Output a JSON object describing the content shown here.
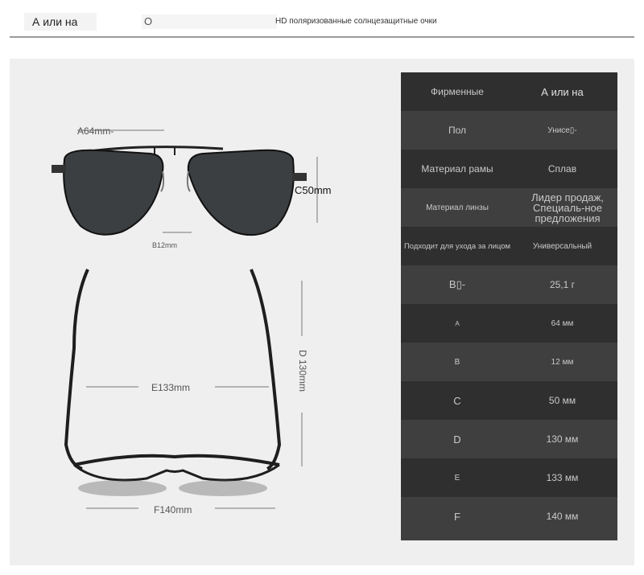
{
  "header": {
    "brand": "А или на",
    "search_glyph": "O",
    "title": "HD поляризованные солнцезащитные очки"
  },
  "dimensions": {
    "a": "A64mm-",
    "b": "B12mm",
    "c": "C50mm",
    "d": "D 130mm",
    "e": "E133mm",
    "f": "F140mm"
  },
  "specs": [
    {
      "key": "Фирменные",
      "value": "А или на"
    },
    {
      "key": "Пол",
      "value": "Унисе▯-"
    },
    {
      "key": "Материал рамы",
      "value": "Сплав"
    },
    {
      "key": "Материал линзы",
      "value": "Лидер продаж, Специаль-ное предложения"
    },
    {
      "key": "Подходит для ухода за лицом",
      "value": "Универсальный"
    },
    {
      "key": "B▯-",
      "value": "25,1 г"
    },
    {
      "key": "A",
      "value": "64 мм"
    },
    {
      "key": "B",
      "value": "12 мм"
    },
    {
      "key": "C",
      "value": "50 мм"
    },
    {
      "key": "D",
      "value": "130 мм"
    },
    {
      "key": "E",
      "value": "133 мм"
    },
    {
      "key": "F",
      "value": "140 мм"
    }
  ],
  "colors": {
    "row_dark": "#2f2f2f",
    "row_light": "#3f3f3f",
    "text": "#c9c9c9",
    "panel": "#efefef"
  }
}
